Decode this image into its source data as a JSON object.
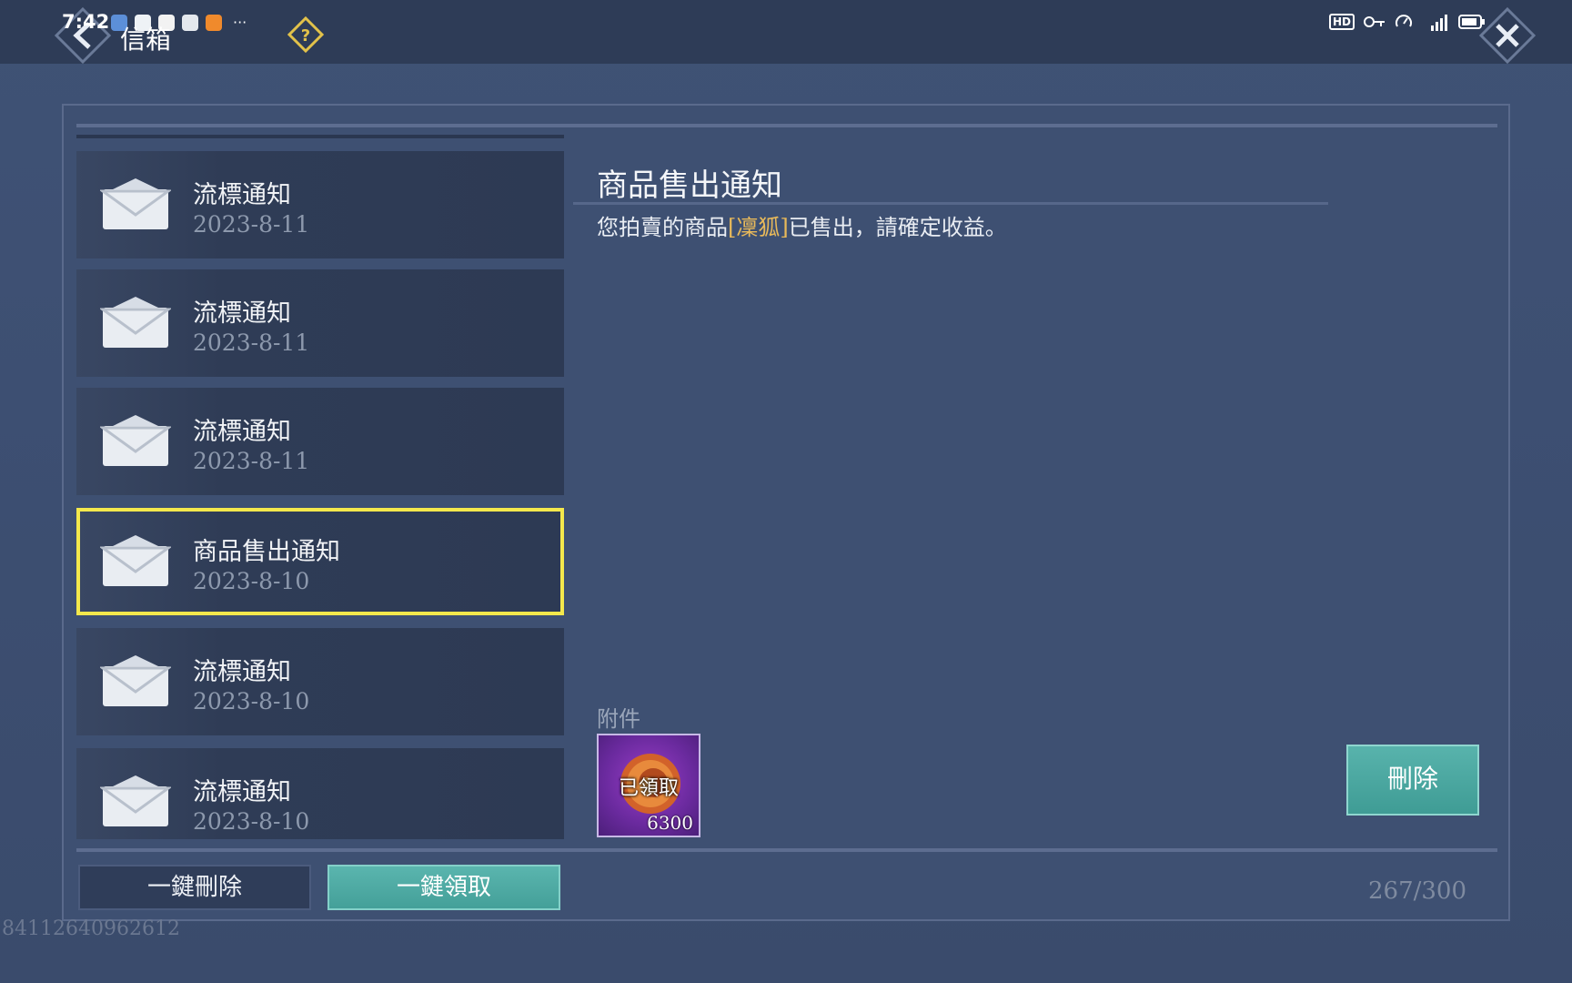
{
  "status_bar": {
    "time": "7:42",
    "more": "···",
    "hd": "HD"
  },
  "header": {
    "title": "信箱"
  },
  "mail_list": [
    {
      "title": "流標通知",
      "date": "2023-8-11",
      "selected": false
    },
    {
      "title": "流標通知",
      "date": "2023-8-11",
      "selected": false
    },
    {
      "title": "流標通知",
      "date": "2023-8-11",
      "selected": false
    },
    {
      "title": "商品售出通知",
      "date": "2023-8-10",
      "selected": true
    },
    {
      "title": "流標通知",
      "date": "2023-8-10",
      "selected": false
    },
    {
      "title": "流標通知",
      "date": "2023-8-10",
      "selected": false
    }
  ],
  "detail": {
    "title": "商品售出通知",
    "body_before": "您拍賣的商品",
    "body_item": "[凜狐]",
    "body_after": "已售出，請確定收益。",
    "attachment_label": "附件",
    "attachment": {
      "status": "已領取",
      "quantity": "6300",
      "icon": "gold-coin-icon"
    },
    "delete_label": "刪除"
  },
  "footer": {
    "delete_all_label": "一鍵刪除",
    "claim_all_label": "一鍵領取",
    "mail_count": "267/300"
  },
  "player_uid": "84112640962612",
  "colors": {
    "accent_teal": "#4aa8a1",
    "selection_yellow": "#f4e84c",
    "highlight_gold": "#e8b95a"
  }
}
